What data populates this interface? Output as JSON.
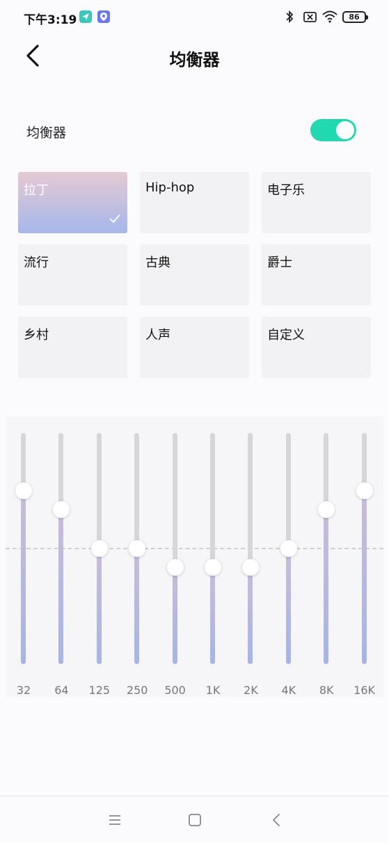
{
  "status_bar": {
    "time": "下午3:19",
    "battery": "86",
    "icons": [
      "navigation-app-icon",
      "vpn-app-icon",
      "bluetooth-icon",
      "sim-off-icon",
      "wifi-icon",
      "battery-icon"
    ]
  },
  "header": {
    "title": "均衡器",
    "back_icon": "chevron-left-icon"
  },
  "toggle": {
    "label": "均衡器",
    "on": true,
    "color": "#22d8b0"
  },
  "presets": [
    {
      "label": "拉丁",
      "selected": true
    },
    {
      "label": "Hip-hop",
      "selected": false
    },
    {
      "label": "电子乐",
      "selected": false
    },
    {
      "label": "流行",
      "selected": false
    },
    {
      "label": "古典",
      "selected": false
    },
    {
      "label": "爵士",
      "selected": false
    },
    {
      "label": "乡村",
      "selected": false
    },
    {
      "label": "人声",
      "selected": false
    },
    {
      "label": "自定义",
      "selected": false
    }
  ],
  "equalizer": {
    "bands": [
      {
        "label": "32",
        "level": 0.75
      },
      {
        "label": "64",
        "level": 0.67
      },
      {
        "label": "125",
        "level": 0.5
      },
      {
        "label": "250",
        "level": 0.5
      },
      {
        "label": "500",
        "level": 0.42
      },
      {
        "label": "1K",
        "level": 0.42
      },
      {
        "label": "2K",
        "level": 0.42
      },
      {
        "label": "4K",
        "level": 0.5
      },
      {
        "label": "8K",
        "level": 0.67
      },
      {
        "label": "16K",
        "level": 0.75
      }
    ]
  },
  "nav_bar": {
    "icons": [
      "menu-icon",
      "home-icon",
      "back-icon"
    ]
  }
}
